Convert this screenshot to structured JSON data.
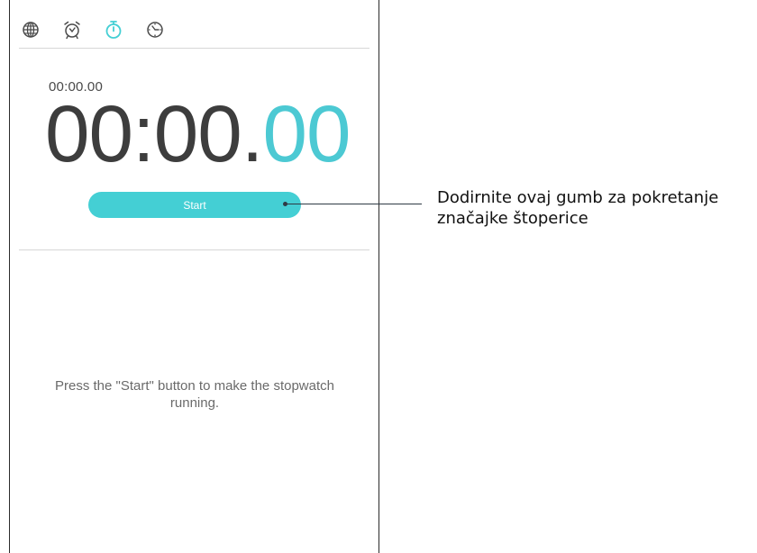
{
  "tabs": [
    {
      "icon": "world-clock-icon",
      "active": false
    },
    {
      "icon": "alarm-icon",
      "active": false
    },
    {
      "icon": "stopwatch-icon",
      "active": true
    },
    {
      "icon": "timer-icon",
      "active": false
    }
  ],
  "stopwatch": {
    "lap_time": "00:00.00",
    "main_time": "00:00.",
    "centiseconds": "00",
    "start_label": "Start",
    "hint": "Press the \"Start\" button to make the stopwatch running."
  },
  "callout": {
    "text": "Dodirnite ovaj gumb za pokretanje značajke štoperice"
  },
  "colors": {
    "accent": "#44cfd4",
    "inactive_icon": "#4a4a4a"
  }
}
